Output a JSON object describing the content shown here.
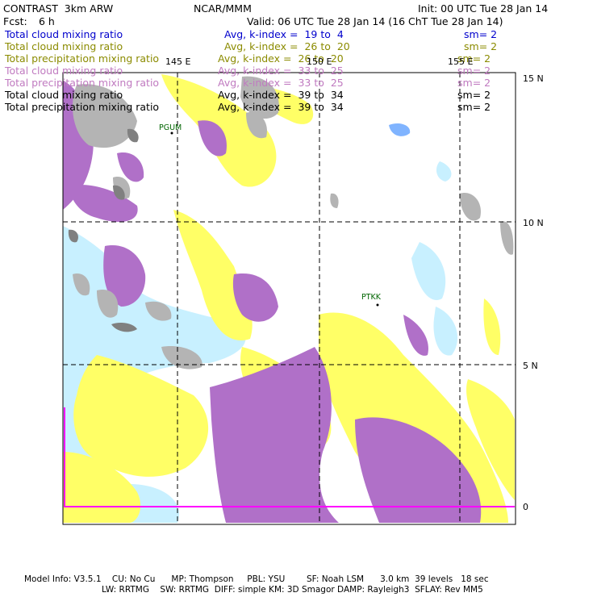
{
  "header": {
    "model": "CONTRAST  3km ARW",
    "center": "NCAR/MMM",
    "init": "Init: 00 UTC Tue 28 Jan 14",
    "fcst_label": "Fcst:",
    "fcst_value": "6 h",
    "valid": "Valid: 06 UTC Tue 28 Jan 14 (16 ChT Tue 28 Jan 14)"
  },
  "fields": [
    {
      "name": "Total cloud mixing ratio",
      "avg": "Avg, k-index =  19 to  4",
      "sm": "sm= 2",
      "color": "#0000cc"
    },
    {
      "name": "Total cloud mixing ratio",
      "avg": "Avg, k-index =  26 to  20",
      "sm": "sm= 2",
      "color": "#8b8b00"
    },
    {
      "name": "Total precipitation mixing ratio",
      "avg": "Avg, k-index =  26 to  20",
      "sm": "sm= 2",
      "color": "#8b8b00"
    },
    {
      "name": "Total cloud mixing ratio",
      "avg": "Avg, k-index =  33 to  25",
      "sm": "sm= 2",
      "color": "#c07ac0"
    },
    {
      "name": "Total precipitation mixing ratio",
      "avg": "Avg, k-index =  33 to  25",
      "sm": "sm= 2",
      "color": "#c07ac0"
    },
    {
      "name": "Total cloud mixing ratio",
      "avg": "Avg, k-index =  39 to  34",
      "sm": "sm= 2",
      "color": "#000000"
    },
    {
      "name": "Total precipitation mixing ratio",
      "avg": "Avg, k-index =  39 to  34",
      "sm": "sm= 2",
      "color": "#000000"
    }
  ],
  "map": {
    "lon_labels": [
      "145 E",
      "150 E",
      "155 E"
    ],
    "lat_labels": [
      "15 N",
      "10 N",
      "5 N",
      "0"
    ],
    "stations": [
      "PGUM",
      "PTKK"
    ],
    "colors": {
      "cyan": "#c8f0ff",
      "yellow": "#ffff66",
      "purple": "#b070c8",
      "gray": "#b4b4b4",
      "gray_dark": "#808080",
      "blue": "#80b4ff",
      "magenta": "#ff00ff",
      "station": "#006400"
    }
  },
  "footer": {
    "line1": "Model Info: V3.5.1    CU: No Cu      MP: Thompson     PBL: YSU        SF: Noah LSM      3.0 km  39 levels   18 sec",
    "line2": "LW: RRTMG    SW: RRTMG  DIFF: simple KM: 3D Smagor DAMP: Rayleigh3  SFLAY: Rev MM5"
  }
}
